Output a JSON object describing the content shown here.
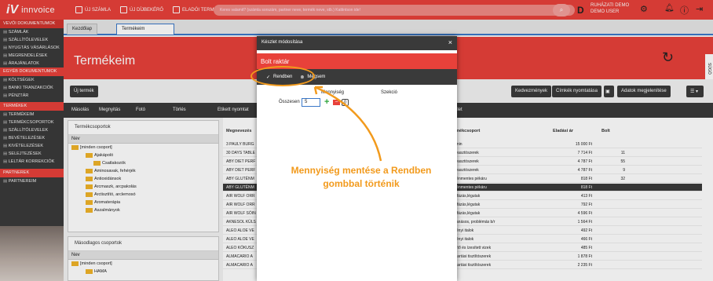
{
  "app": {
    "brand": "innvoice"
  },
  "topbar": {
    "new_invoice": "ÚJ SZÁMLA",
    "new_quote": "ÚJ DÍJBEKÉRŐ",
    "pos": "ELADÓI TERMINÁL",
    "search_placeholder": "Keres valamit? (számla sorszám, partner neve, termék neve, stb.) Kattintson ide!",
    "user_initial": "D",
    "user_line1": "RUHÁZATI DEMO",
    "user_line2": "DEMO USER"
  },
  "sidebar": {
    "section1": "VEVŐI DOKUMENTUMOK",
    "items1": [
      "SZÁMLÁK",
      "SZÁLLÍTÓLEVELEK",
      "NYUGTÁS VÁSÁRLÁSOK",
      "MEGRENDELÉSEK",
      "ÁRAJÁNLATOK"
    ],
    "section2": "EGYÉB DOKUMENTUMOK",
    "items2": [
      "KÖLTSÉGEK",
      "BANKI TRANZAKCIÓK",
      "PÉNZTÁR"
    ],
    "section3": "TERMÉKEK",
    "items3": [
      "TERMÉKEIM",
      "TERMÉKCSOPORTOK",
      "SZÁLLÍTÓLEVELEK",
      "BEVÉTELEZÉSEK",
      "KIVÉTELEZÉSEK",
      "SELEJTEZÉSEK",
      "LELTÁR KORREKCIÓK"
    ],
    "section4": "PARTNEREK",
    "items4": [
      "PARTNEREIM"
    ]
  },
  "tabs": [
    "Kezdőlap",
    "Termékeim"
  ],
  "hero": {
    "title": "Termékeim",
    "side_tab": "SÚGÓ"
  },
  "buttons": {
    "new_product": "Új termék",
    "discounts": "Kedvezmények",
    "print_labels": "Címkék nyomtatása",
    "display_data": "Adatok megjelenítése"
  },
  "toolbar": [
    "Másolás",
    "Megnyitás",
    "Fotó",
    "Törlés",
    "Etikett nyomtat"
  ],
  "groups_panel": {
    "title": "Termékcsoportok",
    "header": "Nev",
    "items": [
      "[minden csoport]",
      "Ajakápoló",
      "Csatlakozók",
      "Aminosavak, fehérjék",
      "Antioxidánsok",
      "Arcmaszk, arcpakolás",
      "Arctisztító, arclemosó",
      "Aromaterápia",
      "Aszalmányok"
    ]
  },
  "secondary_panel": {
    "title": "Másodlagos csoportok",
    "header": "Nev",
    "items": [
      "[minden csoport]",
      "HAMA"
    ]
  },
  "grid": {
    "headers": {
      "name": "Megnevezés",
      "group": "Termékcsoport",
      "price": "Eladási ár",
      "stock": "Bolt"
    },
    "rows": [
      {
        "name": "3 PAULY BURG",
        "group": "Vitamin",
        "price": "15 000 Ft",
        "stock": ""
      },
      {
        "name": "30 DAYS TABLE",
        "group": "Fogyasztószerek",
        "price": "7 714 Ft",
        "stock": "11"
      },
      {
        "name": "ABY DIET PERF",
        "group": "Fogyasztószerek",
        "price": "4 787 Ft",
        "stock": "55"
      },
      {
        "name": "ABY DIET PERF",
        "group": "Fogyasztószerek",
        "price": "4 787 Ft",
        "stock": "9"
      },
      {
        "name": "ABY GLUTÉNM",
        "group": "Gluténmentes pékáru",
        "price": "818 Ft",
        "stock": "32"
      },
      {
        "name": "ABY GLUTÉNM",
        "group": "Gluténmentes pékáru",
        "price": "818 Ft",
        "stock": ""
      },
      {
        "name": "AIR WOLF ORR",
        "group": "Megfázás,légutak",
        "price": "413 Ft",
        "stock": ""
      },
      {
        "name": "AIR WOLF ORR",
        "group": "Megfázás,légutak",
        "price": "792 Ft",
        "stock": ""
      },
      {
        "name": "AIR WOLF SÓIN",
        "group": "Megfázás,légutak",
        "price": "4 596 Ft",
        "stock": ""
      },
      {
        "name": "AKNESOL KÜLS",
        "group": "Pattanásos, problémás b/r",
        "price": "1 564 Ft",
        "stock": ""
      },
      {
        "name": "ALEO ALOE VE",
        "group": "Növényi italok",
        "price": "492 Ft",
        "stock": ""
      },
      {
        "name": "ALEO ALOE VE",
        "group": "Növényi italok",
        "price": "466 Ft",
        "stock": ""
      },
      {
        "name": "ALEO KÓKUSZ",
        "group": "Ízesítő és ízesített vizek",
        "price": "485 Ft",
        "stock": ""
      },
      {
        "name": "ALMACARIO A",
        "group": "Háztartási tisztítószerek",
        "price": "1 878 Ft",
        "stock": ""
      },
      {
        "name": "ALMACARIO A",
        "group": "Háztartási tisztítószerek",
        "price": "2 235 Ft",
        "stock": ""
      }
    ]
  },
  "modal": {
    "title": "Készlet módosítása",
    "subtitle": "Bolt raktár",
    "ok": "Rendben",
    "cancel": "Mégsem",
    "col_qty": "Mennyiség",
    "col_section": "Szekció",
    "total_label": "Összesen",
    "qty_value": "5",
    "zero_label": "0"
  },
  "behind_modal_label": "Készlet",
  "annotation": "Mennyiség mentése a Rendben gombbal történik",
  "colors": {
    "red": "#e8413a",
    "dark": "#3a3a3a",
    "orange": "#f29a1c"
  }
}
